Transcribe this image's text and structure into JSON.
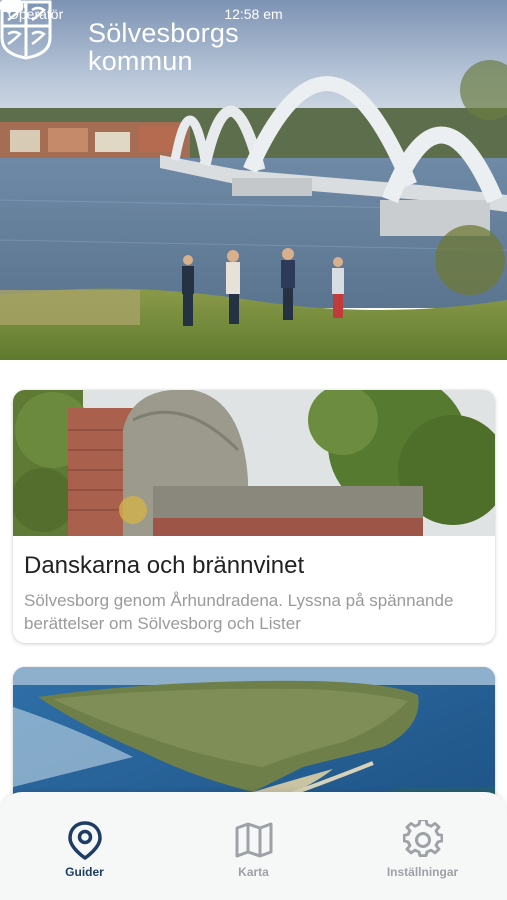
{
  "status_bar": {
    "carrier": "Operatör",
    "time": "12:58 em"
  },
  "header": {
    "brand_line_1": "Sölvesborgs",
    "brand_line_2": "kommun",
    "logo_icon": "solvesborg-coat-of-arms-icon"
  },
  "guides": [
    {
      "title": "Danskarna och brännvinet",
      "description": "Sölvesborg genom Århundradena. Lyssna på spännande berättelser om Sölvesborg och Lister",
      "image": "ruin-stone-tower-photo"
    },
    {
      "title": "",
      "description": "",
      "image": "aerial-island-photo"
    }
  ],
  "tabbar": {
    "items": [
      {
        "label": "Guider",
        "icon": "map-pin-icon",
        "active": true
      },
      {
        "label": "Karta",
        "icon": "folded-map-icon",
        "active": false
      },
      {
        "label": "Inställningar",
        "icon": "gear-icon",
        "active": false
      }
    ],
    "active_color": "#1e3d63",
    "inactive_color": "#9ea2a6"
  }
}
